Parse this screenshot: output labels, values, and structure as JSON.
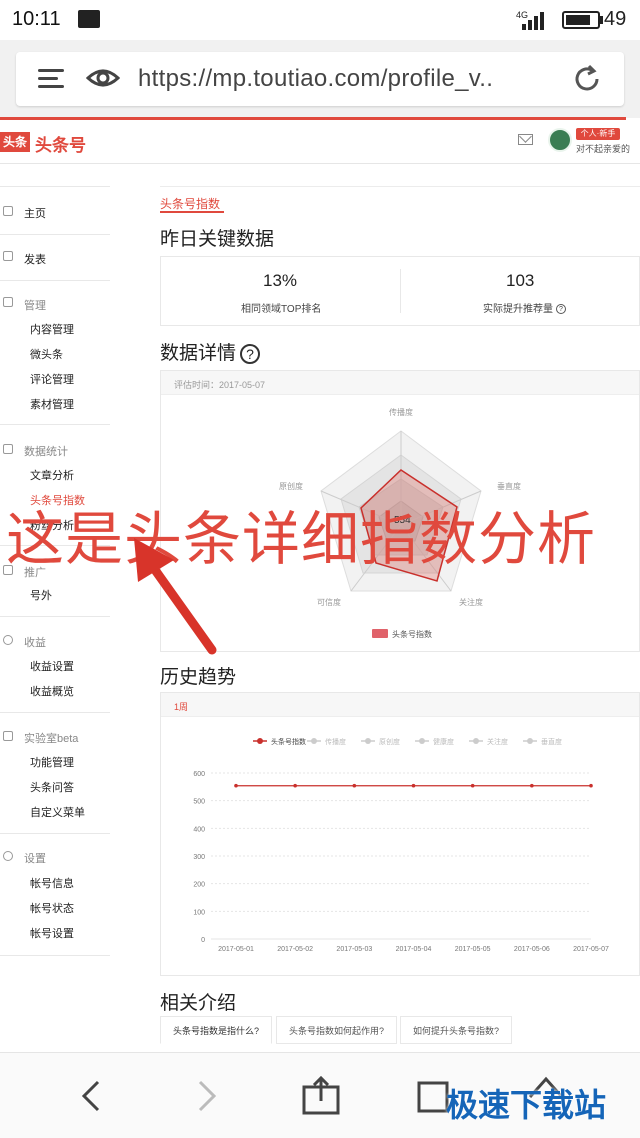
{
  "status_bar": {
    "time": "10:11",
    "network": "4G",
    "battery": "49"
  },
  "browser": {
    "url": "https://mp.toutiao.com/profile_v.."
  },
  "site": {
    "logo_box": "头条",
    "logo_text": "头条号",
    "user_badge": "个人·新手",
    "user_name": "对不起亲爱的"
  },
  "sidebar": {
    "home": "主页",
    "publish": "发表",
    "manage_head": "管理",
    "manage_items": [
      "内容管理",
      "微头条",
      "评论管理",
      "素材管理"
    ],
    "stats_head": "数据统计",
    "stats_items": [
      "文章分析",
      "头条号指数",
      "粉丝分析"
    ],
    "promo_head": "推广",
    "promo_items": [
      "号外"
    ],
    "income_head": "收益",
    "income_items": [
      "收益设置",
      "收益概览"
    ],
    "lab_head": "实验室beta",
    "lab_items": [
      "功能管理",
      "头条问答",
      "自定义菜单"
    ],
    "settings_head": "设置",
    "settings_items": [
      "帐号信息",
      "帐号状态",
      "帐号设置"
    ]
  },
  "main": {
    "tab": "头条号指数",
    "yesterday_title": "昨日关键数据",
    "kpi1_value": "13%",
    "kpi1_label": "相同领域TOP排名",
    "kpi2_value": "103",
    "kpi2_label": "实际提升推荐量",
    "detail_title": "数据详情",
    "eval_time": "评估时间：2017-05-07",
    "radar_center": "554",
    "radar_axes": [
      "传播度",
      "垂直度",
      "关注度",
      "可信度",
      "原创度"
    ],
    "radar_legend": "头条号指数",
    "history_title": "历史趋势",
    "history_period": "1周",
    "history_legend": [
      "头条号指数",
      "传播度",
      "原创度",
      "健康度",
      "关注度",
      "垂直度"
    ],
    "related_title": "相关介绍",
    "related_tabs": [
      "头条号指数是指什么?",
      "头条号指数如何起作用?",
      "如何提升头条号指数?"
    ]
  },
  "overlay_text": "这是头条详细指数分析",
  "watermark": "极速下载站",
  "accent_color": "#e0493d",
  "chart_data": {
    "type": "line",
    "categories": [
      "2017-05-01",
      "2017-05-02",
      "2017-05-03",
      "2017-05-04",
      "2017-05-05",
      "2017-05-06",
      "2017-05-07"
    ],
    "series": [
      {
        "name": "头条号指数",
        "values": [
          554,
          554,
          554,
          554,
          554,
          554,
          554
        ]
      }
    ],
    "yticks": [
      "0",
      "100",
      "200",
      "300",
      "400",
      "500",
      "600"
    ],
    "ylim": [
      0,
      600
    ],
    "grid": true,
    "legend": "top"
  }
}
